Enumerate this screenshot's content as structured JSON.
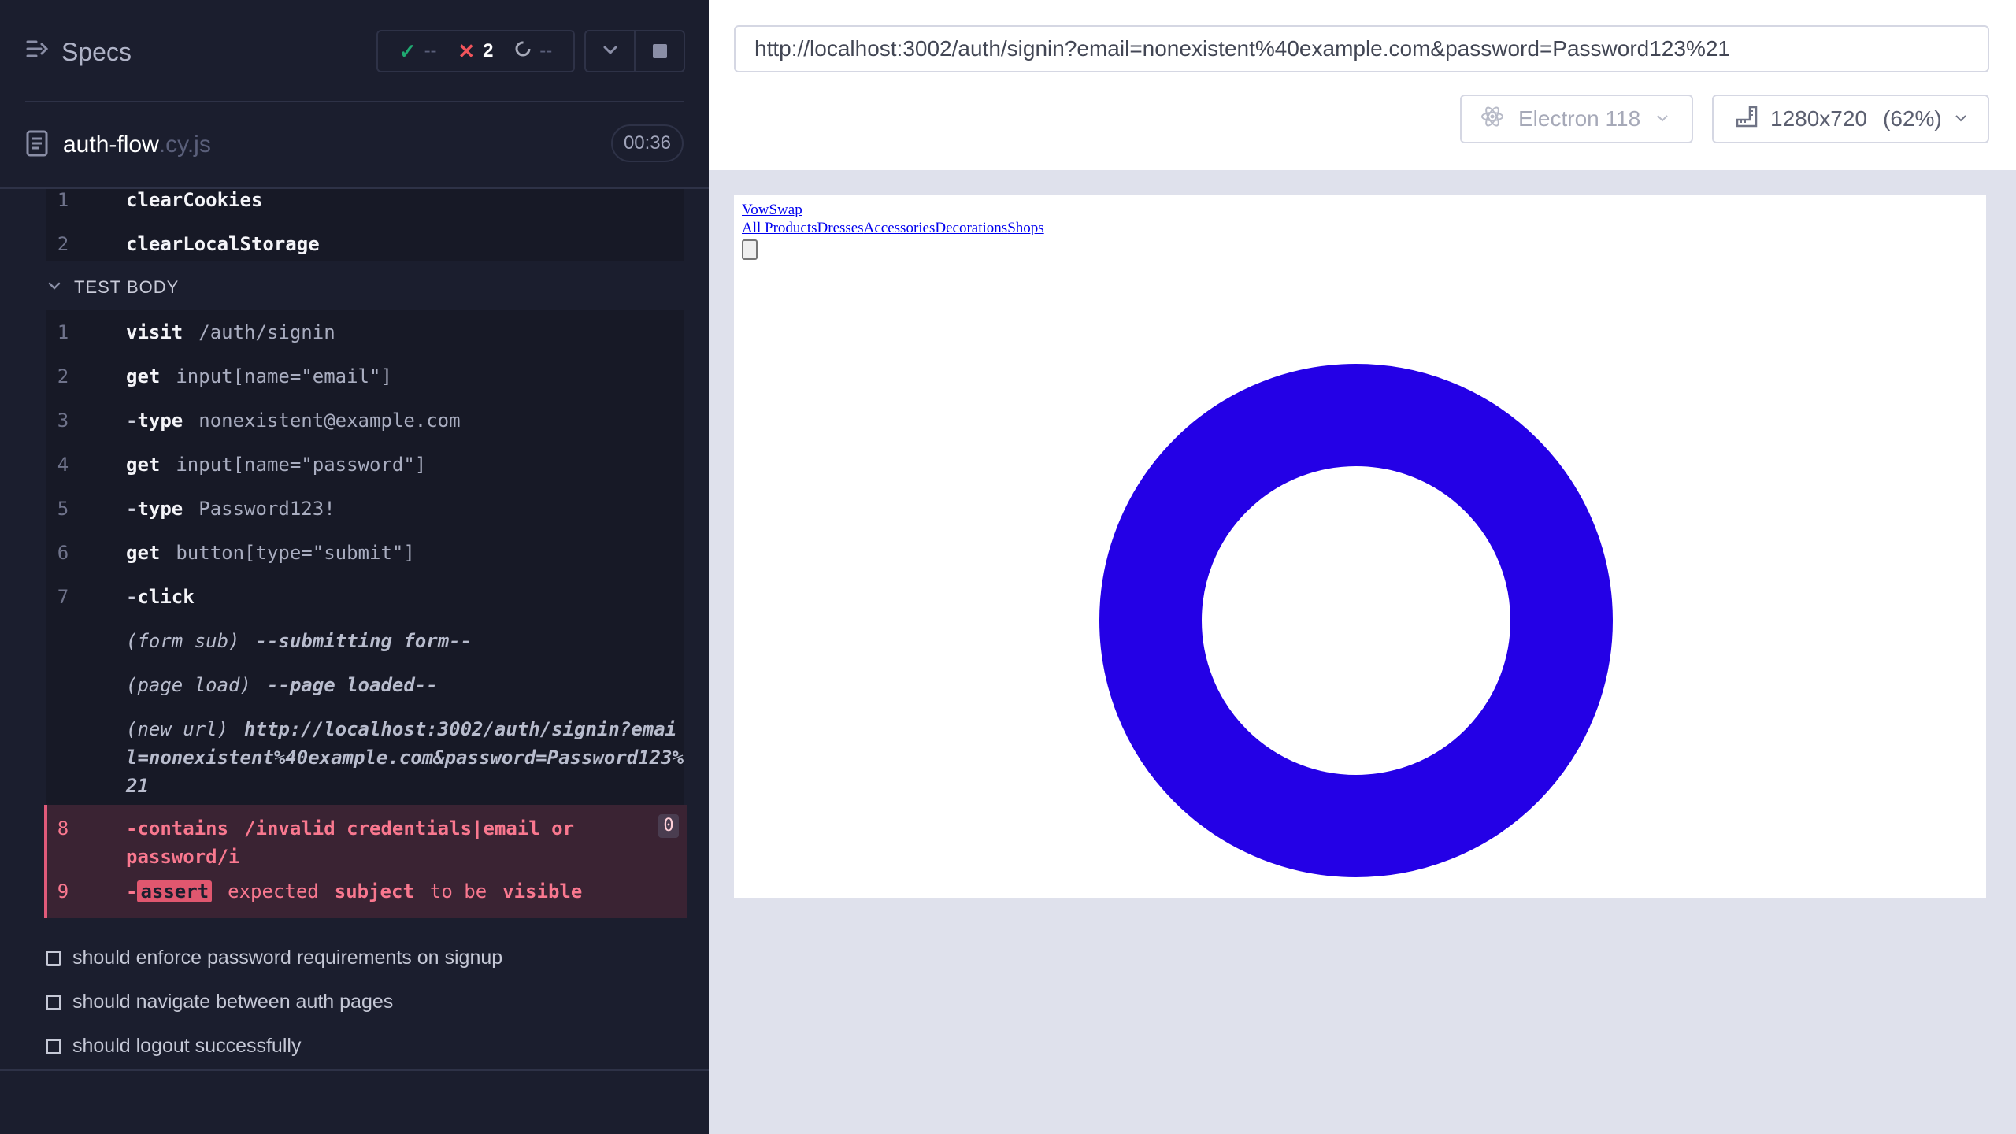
{
  "reporter": {
    "specs_label": "Specs",
    "stats": {
      "passed": "--",
      "failed": "2",
      "pending": "--"
    },
    "spec_file": {
      "name": "auth-flow",
      "ext": ".cy.js",
      "duration": "00:36"
    },
    "hook_commands": [
      {
        "num": "1",
        "name": "clearCookies"
      },
      {
        "num": "2",
        "name": "clearLocalStorage"
      }
    ],
    "test_body_label": "TEST BODY",
    "commands": [
      {
        "num": "1",
        "name": "visit",
        "msg": "/auth/signin"
      },
      {
        "num": "2",
        "name": "get",
        "msg": "input[name=\"email\"]"
      },
      {
        "num": "3",
        "name": "type",
        "msg": "nonexistent@example.com"
      },
      {
        "num": "4",
        "name": "get",
        "msg": "input[name=\"password\"]"
      },
      {
        "num": "5",
        "name": "type",
        "msg": "Password123!"
      },
      {
        "num": "6",
        "name": "get",
        "msg": "button[type=\"submit\"]"
      },
      {
        "num": "7",
        "name": "click",
        "msg": ""
      }
    ],
    "events": [
      {
        "name": "(form sub)",
        "msg": "--submitting form--"
      },
      {
        "name": "(page load)",
        "msg": "--page loaded--"
      },
      {
        "name": "(new url)",
        "msg": "http://localhost:3002/auth/signin?email=nonexistent%40example.com&password=Password123%21"
      }
    ],
    "failed_commands": {
      "contains": {
        "num": "8",
        "name": "contains",
        "msg": "/invalid credentials|email or password/i",
        "count": "0"
      },
      "assert": {
        "num": "9",
        "name": "assert",
        "w1": "expected",
        "w2": "subject",
        "w3": "to be",
        "w4": "visible"
      }
    },
    "pending_tests": [
      "should enforce password requirements on signup",
      "should navigate between auth pages",
      "should logout successfully"
    ]
  },
  "aut": {
    "url": "http://localhost:3002/auth/signin?email=nonexistent%40example.com&password=Password123%21",
    "browser": "Electron 118",
    "viewport": "1280x720",
    "viewport_scale": "(62%)",
    "app": {
      "brand": "VowSwap",
      "nav": [
        "All Products",
        "Dresses",
        "Accessories",
        "Decorations",
        "Shops"
      ]
    }
  },
  "colors": {
    "reporter_bg": "#1b1e2e",
    "failed_text": "#f9788f",
    "spinner": "#2400e6",
    "pass": "#1fa971",
    "fail": "#f2545b"
  }
}
